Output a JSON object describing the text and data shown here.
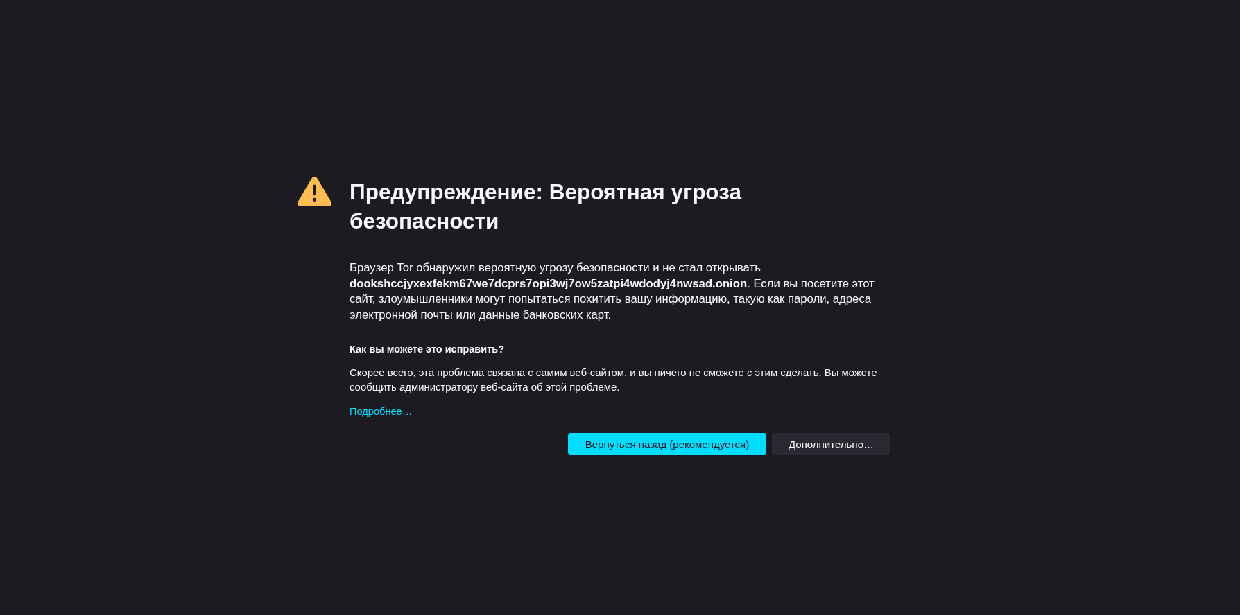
{
  "alert": {
    "title": "Предупреждение: Вероятная угроза безопасности",
    "description": "Браузер Tor обнаружил вероятную угрозу безопасности и не стал открывать **dookshccjyxexfekm67we7dcprs7opi3wj7ow5zatpi4wdodyj4nwsad.onion**. Если вы посетите этот сайт, злоумышленники могут попытаться похитить вашу информацию, такую как пароли, адреса электронной почты или данные банковских карт.",
    "help_heading": "Как вы можете это исправить?",
    "help_text": "Скорее всего, эта проблема связана с самим веб-сайтом, и вы ничего не сможете с этим сделать. Вы можете сообщить администратору веб-сайта об этой проблеме.",
    "learn_more_link": "Подробнее…"
  },
  "buttons": [
    {
      "label": "Вернуться назад (рекомендуется)",
      "kind": "primary"
    },
    {
      "label": "Дополнительно…",
      "kind": "secondary"
    }
  ]
}
